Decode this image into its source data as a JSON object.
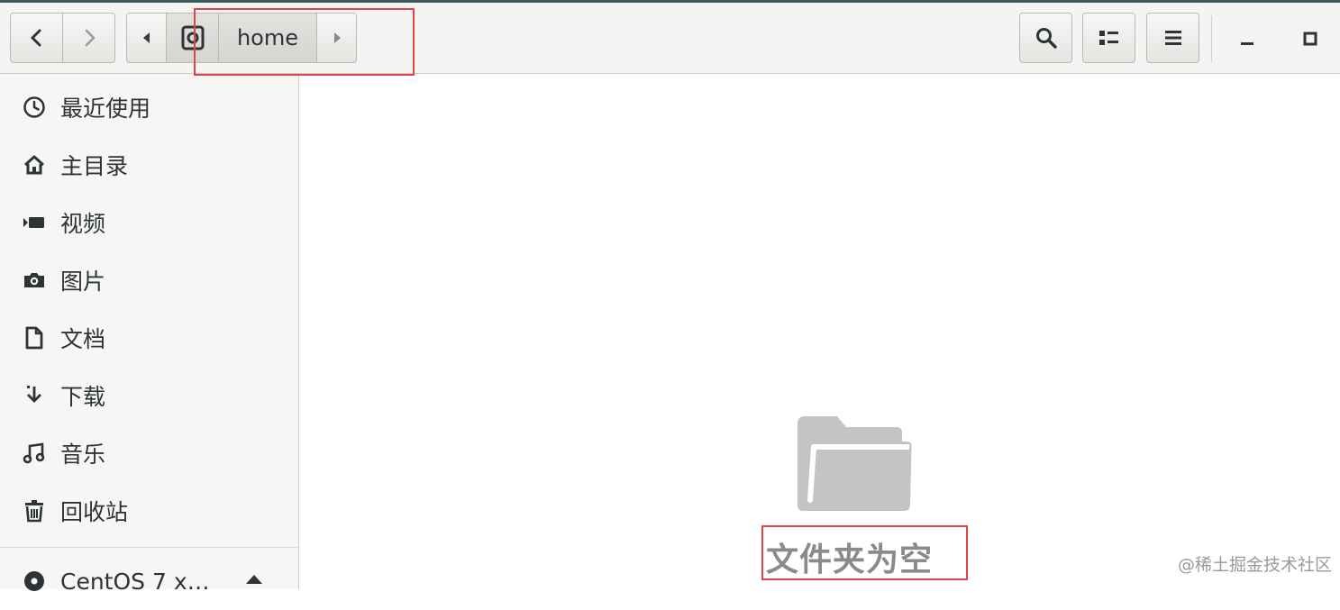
{
  "header": {
    "path_segment": "home",
    "icons": {
      "back": "chevron-left-icon",
      "forward": "chevron-right-icon",
      "path_left": "triangle-left-icon",
      "path_right": "triangle-right-icon",
      "root": "drive-icon",
      "search": "search-icon",
      "view": "list-view-icon",
      "menu": "hamburger-menu-icon",
      "minimize": "minimize-icon",
      "maximize": "maximize-icon"
    }
  },
  "sidebar": {
    "items": [
      {
        "label": "最近使用",
        "icon": "clock-icon"
      },
      {
        "label": "主目录",
        "icon": "home-icon"
      },
      {
        "label": "视频",
        "icon": "video-icon"
      },
      {
        "label": "图片",
        "icon": "camera-icon"
      },
      {
        "label": "文档",
        "icon": "document-icon"
      },
      {
        "label": "下载",
        "icon": "download-icon"
      },
      {
        "label": "音乐",
        "icon": "music-icon"
      },
      {
        "label": "回收站",
        "icon": "trash-icon"
      }
    ],
    "device": {
      "label": "CentOS 7 x…",
      "icon": "disc-icon",
      "action_icon": "eject-icon"
    }
  },
  "main": {
    "empty_icon": "folder-icon",
    "empty_text": "文件夹为空"
  },
  "watermark": "@稀土掘金技术社区",
  "colors": {
    "highlight": "#e04444",
    "header_bg": "#f4f4f3",
    "sidebar_bg": "#f6f6f5",
    "folder_gray": "#c4c4c4"
  }
}
